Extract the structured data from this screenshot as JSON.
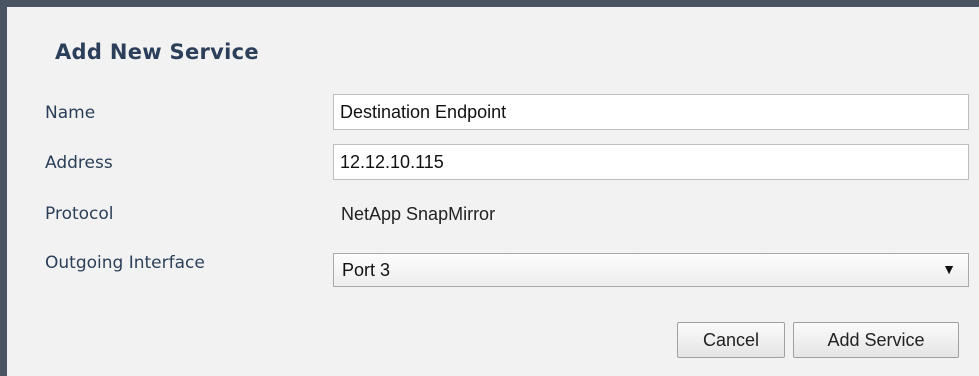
{
  "dialog": {
    "title": "Add New Service"
  },
  "form": {
    "name": {
      "label": "Name",
      "value": "Destination Endpoint"
    },
    "address": {
      "label": "Address",
      "value": "12.12.10.115"
    },
    "protocol": {
      "label": "Protocol",
      "value": "NetApp SnapMirror"
    },
    "outgoing_interface": {
      "label": "Outgoing Interface",
      "value": "Port 3",
      "arrow": "▼",
      "arrow_icon": "dropdown-arrow-icon"
    }
  },
  "buttons": {
    "cancel_label": "Cancel",
    "add_label": "Add Service"
  },
  "colors": {
    "frame": "#4a5563",
    "dialog_bg": "#f2f2f2",
    "label_text": "#2b3f5a"
  }
}
